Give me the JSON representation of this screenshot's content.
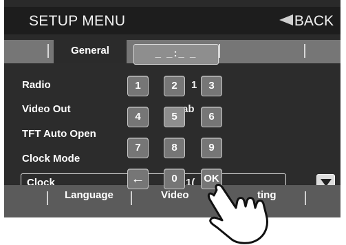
{
  "header": {
    "title": "SETUP MENU",
    "back_label": "BACK"
  },
  "tabs": {
    "active": "General",
    "time_display": "_ _:_ _"
  },
  "settings": [
    {
      "label": "Radio",
      "value": "1"
    },
    {
      "label": "Video Out",
      "value": "ab"
    },
    {
      "label": "TFT Auto Open",
      "value": ""
    },
    {
      "label": "Clock Mode",
      "value": ""
    },
    {
      "label": "Clock",
      "value": "1("
    }
  ],
  "keypad": [
    "1",
    "2",
    "3",
    "4",
    "5",
    "6",
    "7",
    "8",
    "9",
    "←",
    "0",
    "OK"
  ],
  "bottom_tabs": [
    "Language",
    "Video",
    "ting"
  ],
  "icons": {
    "back": "back-arrow-icon",
    "scroll": "triangle-down-icon",
    "pointer": "pointing-hand-icon"
  }
}
